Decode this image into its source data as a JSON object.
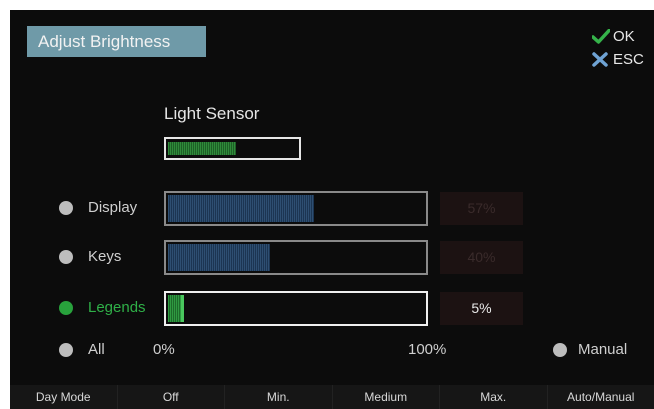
{
  "title": "Adjust Brightness",
  "legend": {
    "ok_label": "OK",
    "esc_label": "ESC",
    "ok_icon": "check-icon",
    "esc_icon": "x-icon",
    "ok_color": "#35b34a",
    "esc_color": "#6fa3d4"
  },
  "sensor": {
    "label": "Light Sensor",
    "level": 0.53
  },
  "options": [
    {
      "label": "Display",
      "value": 0.57,
      "percent": "57%",
      "selected": false
    },
    {
      "label": "Keys",
      "value": 0.4,
      "percent": "40%",
      "selected": false
    },
    {
      "label": "Legends",
      "value": 0.05,
      "percent": "5%",
      "selected": true
    }
  ],
  "scale": {
    "all_label": "All",
    "min_label": "0%",
    "max_label": "100%",
    "manual_label": "Manual"
  },
  "softkeys": [
    "Day Mode",
    "Off",
    "Min.",
    "Medium",
    "Max.",
    "Auto/Manual"
  ],
  "colors": {
    "accent": "#6f9aa8",
    "selected": "#2fb048",
    "bar_fill": "#2e4f72"
  }
}
